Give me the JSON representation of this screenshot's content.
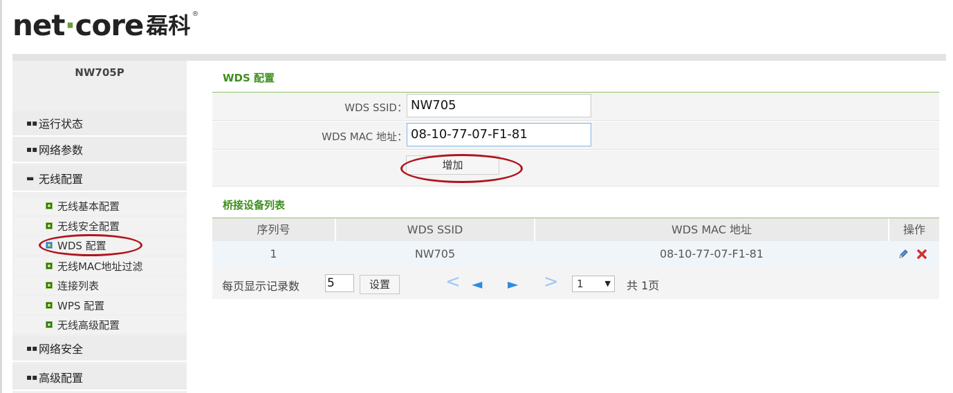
{
  "brand": {
    "logo_left": "net",
    "logo_dot": "·",
    "logo_right": "core",
    "logo_cn": "磊科",
    "logo_reg": "®"
  },
  "sidebar": {
    "model": "NW705P",
    "menu": [
      {
        "label": "运行状态",
        "icon": "grid-icon"
      },
      {
        "label": "网络参数",
        "icon": "grid-icon"
      },
      {
        "label": "无线配置",
        "icon": "minus-icon"
      }
    ],
    "submenu": [
      {
        "label": "无线基本配置"
      },
      {
        "label": "无线安全配置"
      },
      {
        "label": "WDS 配置"
      },
      {
        "label": "无线MAC地址过滤"
      },
      {
        "label": "连接列表"
      },
      {
        "label": "WPS 配置"
      },
      {
        "label": "无线高级配置"
      }
    ],
    "menu_bottom": [
      {
        "label": "网络安全",
        "icon": "grid-icon"
      },
      {
        "label": "高级配置",
        "icon": "grid-icon"
      }
    ]
  },
  "wds_config": {
    "title": "WDS 配置",
    "ssid_label": "WDS SSID：",
    "ssid_value": "NW705",
    "mac_label": "WDS MAC 地址：",
    "mac_value": "08-10-77-07-F1-81",
    "add_button": "增加"
  },
  "bridge_list": {
    "title": "桥接设备列表",
    "headers": [
      "序列号",
      "WDS SSID",
      "WDS MAC 地址",
      "操作"
    ],
    "rows": [
      {
        "index": "1",
        "ssid": "NW705",
        "mac": "08-10-77-07-F1-81"
      }
    ]
  },
  "pager": {
    "per_page_label": "每页显示记录数",
    "per_page_value": "5",
    "set_button": "设置",
    "nav": [
      "<",
      "◄",
      "►",
      ">"
    ],
    "page_select": "1",
    "total": "共 1页"
  },
  "colors": {
    "accent_green": "#3e8e1e",
    "annotation_red": "#b0151d",
    "nav_blue": "#2f8be0"
  }
}
